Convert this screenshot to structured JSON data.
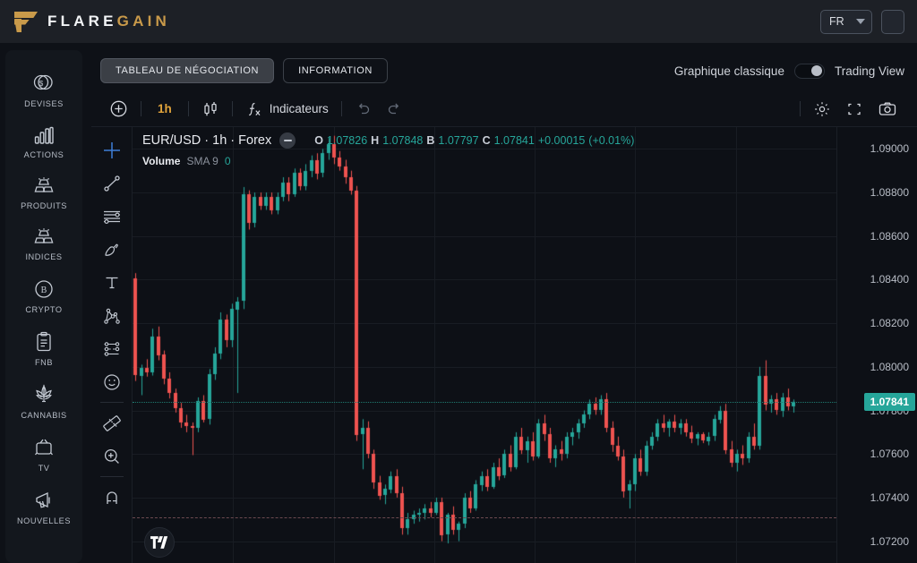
{
  "header": {
    "brand_white": "FLARE",
    "brand_gold": "GAIN",
    "language": "FR"
  },
  "sidebar": {
    "items": [
      {
        "label": "DEVISES",
        "icon": "coins-dollar-icon"
      },
      {
        "label": "ACTIONS",
        "icon": "bar-chart-icon"
      },
      {
        "label": "PRODUITS",
        "icon": "gold-bars-icon"
      },
      {
        "label": "INDICES",
        "icon": "gold-bars-icon"
      },
      {
        "label": "CRYPTO",
        "icon": "bitcoin-circle-icon"
      },
      {
        "label": "FNB",
        "icon": "clipboard-icon"
      },
      {
        "label": "CANNABIS",
        "icon": "cannabis-leaf-icon"
      },
      {
        "label": "TV",
        "icon": "television-icon"
      },
      {
        "label": "NOUVELLES",
        "icon": "megaphone-icon"
      }
    ]
  },
  "tabs": {
    "trading_board": "TABLEAU DE NÉGOCIATION",
    "information": "INFORMATION",
    "classic_chart_label": "Graphique classique",
    "trading_view_label": "Trading View",
    "toggle_state": "Trading View"
  },
  "chart_toolbar": {
    "add_label": "+",
    "interval": "1h",
    "chart_type_icon": "candlestick-icon",
    "indicators_label": "Indicateurs",
    "indicators_icon": "fx-icon",
    "undo_icon": "undo-icon",
    "redo_icon": "redo-icon",
    "settings_icon": "gear-icon",
    "fullscreen_icon": "fullscreen-icon",
    "snapshot_icon": "camera-icon"
  },
  "drawing_tools": [
    {
      "name": "crosshair-tool",
      "active": true
    },
    {
      "name": "trend-line-tool",
      "active": false
    },
    {
      "name": "horizontal-levels-tool",
      "active": false
    },
    {
      "name": "brush-tool",
      "active": false
    },
    {
      "name": "text-tool",
      "active": false
    },
    {
      "name": "pattern-tool",
      "active": false
    },
    {
      "name": "forecast-tool",
      "active": false
    },
    {
      "name": "emoji-tool",
      "active": false
    },
    {
      "name": "measure-tool",
      "active": false
    },
    {
      "name": "zoom-in-tool",
      "active": false
    },
    {
      "name": "magnet-tool",
      "active": false
    }
  ],
  "chart_data": {
    "type": "candlestick",
    "symbol": "EUR/USD",
    "interval": "1h",
    "exchange": "Forex",
    "title": "EUR/USD · 1h · Forex",
    "ohlc": {
      "o_label": "O",
      "o": "1.07826",
      "h_label": "H",
      "h": "1.07848",
      "b_label": "B",
      "b": "1.07797",
      "c_label": "C",
      "c": "1.07841",
      "change": "+0.00015",
      "change_pct": "(+0.01%)"
    },
    "volume_study": {
      "name": "Volume",
      "params": "SMA 9",
      "value": "0"
    },
    "current_price": "1.07841",
    "ylabel": "",
    "ylim": [
      1.071,
      1.091
    ],
    "yticks": [
      "1.09000",
      "1.08800",
      "1.08600",
      "1.08400",
      "1.08200",
      "1.08000",
      "1.07800",
      "1.07600",
      "1.07400",
      "1.07200"
    ],
    "ytick_values": [
      1.09,
      1.088,
      1.086,
      1.084,
      1.082,
      1.08,
      1.078,
      1.076,
      1.074,
      1.072
    ],
    "price_level_line": 1.07841,
    "low_level_line": 1.0731,
    "grid": true,
    "up_color": "#26a69a",
    "down_color": "#ef5350",
    "bars": [
      {
        "o": 1.08405,
        "h": 1.0843,
        "l": 1.07935,
        "c": 1.0796
      },
      {
        "o": 1.0796,
        "h": 1.0801,
        "l": 1.0787,
        "c": 1.07995
      },
      {
        "o": 1.07995,
        "h": 1.08035,
        "l": 1.07955,
        "c": 1.07975
      },
      {
        "o": 1.07975,
        "h": 1.08175,
        "l": 1.0796,
        "c": 1.0814
      },
      {
        "o": 1.0814,
        "h": 1.08185,
        "l": 1.0803,
        "c": 1.08055
      },
      {
        "o": 1.08055,
        "h": 1.08075,
        "l": 1.0792,
        "c": 1.07945
      },
      {
        "o": 1.07945,
        "h": 1.07975,
        "l": 1.07855,
        "c": 1.0788
      },
      {
        "o": 1.0788,
        "h": 1.079,
        "l": 1.0779,
        "c": 1.0781
      },
      {
        "o": 1.0781,
        "h": 1.07835,
        "l": 1.0772,
        "c": 1.07745
      },
      {
        "o": 1.07745,
        "h": 1.0778,
        "l": 1.077,
        "c": 1.0773
      },
      {
        "o": 1.0773,
        "h": 1.07745,
        "l": 1.07595,
        "c": 1.0772
      },
      {
        "o": 1.0772,
        "h": 1.0786,
        "l": 1.077,
        "c": 1.07845
      },
      {
        "o": 1.07845,
        "h": 1.0787,
        "l": 1.07745,
        "c": 1.0776
      },
      {
        "o": 1.0776,
        "h": 1.0799,
        "l": 1.07735,
        "c": 1.07965
      },
      {
        "o": 1.07965,
        "h": 1.0809,
        "l": 1.0794,
        "c": 1.0806
      },
      {
        "o": 1.0806,
        "h": 1.0825,
        "l": 1.08035,
        "c": 1.08215
      },
      {
        "o": 1.08215,
        "h": 1.0824,
        "l": 1.0809,
        "c": 1.0812
      },
      {
        "o": 1.0812,
        "h": 1.0829,
        "l": 1.0809,
        "c": 1.08265
      },
      {
        "o": 1.08265,
        "h": 1.0832,
        "l": 1.0788,
        "c": 1.083
      },
      {
        "o": 1.083,
        "h": 1.08825,
        "l": 1.08265,
        "c": 1.0879
      },
      {
        "o": 1.0879,
        "h": 1.0881,
        "l": 1.0863,
        "c": 1.0866
      },
      {
        "o": 1.0866,
        "h": 1.088,
        "l": 1.0864,
        "c": 1.0878
      },
      {
        "o": 1.0878,
        "h": 1.088,
        "l": 1.0872,
        "c": 1.0874
      },
      {
        "o": 1.0874,
        "h": 1.088,
        "l": 1.0872,
        "c": 1.0878
      },
      {
        "o": 1.0878,
        "h": 1.088,
        "l": 1.087,
        "c": 1.0872
      },
      {
        "o": 1.0872,
        "h": 1.088,
        "l": 1.087,
        "c": 1.0878
      },
      {
        "o": 1.0878,
        "h": 1.0887,
        "l": 1.0876,
        "c": 1.08845
      },
      {
        "o": 1.08845,
        "h": 1.0887,
        "l": 1.0876,
        "c": 1.0879
      },
      {
        "o": 1.0879,
        "h": 1.0891,
        "l": 1.0878,
        "c": 1.0889
      },
      {
        "o": 1.0889,
        "h": 1.0891,
        "l": 1.0881,
        "c": 1.0883
      },
      {
        "o": 1.0883,
        "h": 1.0893,
        "l": 1.0881,
        "c": 1.089
      },
      {
        "o": 1.089,
        "h": 1.0897,
        "l": 1.0887,
        "c": 1.0895
      },
      {
        "o": 1.0895,
        "h": 1.0898,
        "l": 1.0886,
        "c": 1.0889
      },
      {
        "o": 1.0889,
        "h": 1.09,
        "l": 1.0887,
        "c": 1.0898
      },
      {
        "o": 1.0898,
        "h": 1.0905,
        "l": 1.0895,
        "c": 1.0902
      },
      {
        "o": 1.0902,
        "h": 1.0906,
        "l": 1.0893,
        "c": 1.0896
      },
      {
        "o": 1.0896,
        "h": 1.0899,
        "l": 1.089,
        "c": 1.0892
      },
      {
        "o": 1.0892,
        "h": 1.0895,
        "l": 1.0884,
        "c": 1.0887
      },
      {
        "o": 1.0887,
        "h": 1.089,
        "l": 1.0879,
        "c": 1.0881
      },
      {
        "o": 1.0881,
        "h": 1.0883,
        "l": 1.0766,
        "c": 1.0769
      },
      {
        "o": 1.0769,
        "h": 1.0776,
        "l": 1.0753,
        "c": 1.0772
      },
      {
        "o": 1.0772,
        "h": 1.0775,
        "l": 1.0758,
        "c": 1.076
      },
      {
        "o": 1.076,
        "h": 1.0762,
        "l": 1.0744,
        "c": 1.0747
      },
      {
        "o": 1.0747,
        "h": 1.075,
        "l": 1.0739,
        "c": 1.0741
      },
      {
        "o": 1.0741,
        "h": 1.0746,
        "l": 1.0737,
        "c": 1.0744
      },
      {
        "o": 1.0744,
        "h": 1.0752,
        "l": 1.0742,
        "c": 1.075
      },
      {
        "o": 1.075,
        "h": 1.0753,
        "l": 1.074,
        "c": 1.0742
      },
      {
        "o": 1.0742,
        "h": 1.0745,
        "l": 1.0723,
        "c": 1.0726
      },
      {
        "o": 1.0726,
        "h": 1.0733,
        "l": 1.0723,
        "c": 1.073
      },
      {
        "o": 1.073,
        "h": 1.0734,
        "l": 1.0728,
        "c": 1.0732
      },
      {
        "o": 1.0732,
        "h": 1.0735,
        "l": 1.0729,
        "c": 1.0733
      },
      {
        "o": 1.0733,
        "h": 1.0737,
        "l": 1.073,
        "c": 1.0735
      },
      {
        "o": 1.0735,
        "h": 1.0738,
        "l": 1.0731,
        "c": 1.0733
      },
      {
        "o": 1.0733,
        "h": 1.074,
        "l": 1.0732,
        "c": 1.0738
      },
      {
        "o": 1.0738,
        "h": 1.074,
        "l": 1.072,
        "c": 1.0723
      },
      {
        "o": 1.0723,
        "h": 1.0733,
        "l": 1.0719,
        "c": 1.0732
      },
      {
        "o": 1.0732,
        "h": 1.0736,
        "l": 1.0723,
        "c": 1.0725
      },
      {
        "o": 1.0725,
        "h": 1.0729,
        "l": 1.072,
        "c": 1.0728
      },
      {
        "o": 1.0728,
        "h": 1.0742,
        "l": 1.0726,
        "c": 1.074
      },
      {
        "o": 1.074,
        "h": 1.0743,
        "l": 1.0733,
        "c": 1.0735
      },
      {
        "o": 1.0735,
        "h": 1.0748,
        "l": 1.0734,
        "c": 1.0746
      },
      {
        "o": 1.0746,
        "h": 1.0752,
        "l": 1.0743,
        "c": 1.075
      },
      {
        "o": 1.075,
        "h": 1.0753,
        "l": 1.0743,
        "c": 1.0745
      },
      {
        "o": 1.0745,
        "h": 1.0756,
        "l": 1.0744,
        "c": 1.0754
      },
      {
        "o": 1.0754,
        "h": 1.0758,
        "l": 1.0748,
        "c": 1.075
      },
      {
        "o": 1.075,
        "h": 1.0762,
        "l": 1.0749,
        "c": 1.076
      },
      {
        "o": 1.076,
        "h": 1.0764,
        "l": 1.0752,
        "c": 1.0754
      },
      {
        "o": 1.0754,
        "h": 1.077,
        "l": 1.0753,
        "c": 1.0768
      },
      {
        "o": 1.0768,
        "h": 1.0772,
        "l": 1.076,
        "c": 1.0762
      },
      {
        "o": 1.0762,
        "h": 1.0768,
        "l": 1.0756,
        "c": 1.0766
      },
      {
        "o": 1.0766,
        "h": 1.077,
        "l": 1.0757,
        "c": 1.0759
      },
      {
        "o": 1.0759,
        "h": 1.0776,
        "l": 1.0758,
        "c": 1.0774
      },
      {
        "o": 1.0774,
        "h": 1.0778,
        "l": 1.0766,
        "c": 1.0769
      },
      {
        "o": 1.0769,
        "h": 1.0772,
        "l": 1.0756,
        "c": 1.0758
      },
      {
        "o": 1.0758,
        "h": 1.0764,
        "l": 1.0754,
        "c": 1.0762
      },
      {
        "o": 1.0762,
        "h": 1.0766,
        "l": 1.0757,
        "c": 1.076
      },
      {
        "o": 1.076,
        "h": 1.077,
        "l": 1.0758,
        "c": 1.0768
      },
      {
        "o": 1.0768,
        "h": 1.0772,
        "l": 1.0764,
        "c": 1.077
      },
      {
        "o": 1.077,
        "h": 1.0776,
        "l": 1.0767,
        "c": 1.0774
      },
      {
        "o": 1.0774,
        "h": 1.078,
        "l": 1.0772,
        "c": 1.0778
      },
      {
        "o": 1.0778,
        "h": 1.0785,
        "l": 1.0776,
        "c": 1.0783
      },
      {
        "o": 1.0783,
        "h": 1.0786,
        "l": 1.0778,
        "c": 1.078
      },
      {
        "o": 1.078,
        "h": 1.0787,
        "l": 1.0778,
        "c": 1.0785
      },
      {
        "o": 1.0785,
        "h": 1.0788,
        "l": 1.077,
        "c": 1.0772
      },
      {
        "o": 1.0772,
        "h": 1.0775,
        "l": 1.0761,
        "c": 1.0764
      },
      {
        "o": 1.0764,
        "h": 1.0768,
        "l": 1.0757,
        "c": 1.0759
      },
      {
        "o": 1.0759,
        "h": 1.0762,
        "l": 1.074,
        "c": 1.0743
      },
      {
        "o": 1.0743,
        "h": 1.0748,
        "l": 1.0735,
        "c": 1.0746
      },
      {
        "o": 1.0746,
        "h": 1.076,
        "l": 1.0743,
        "c": 1.0758
      },
      {
        "o": 1.0758,
        "h": 1.0762,
        "l": 1.075,
        "c": 1.0752
      },
      {
        "o": 1.0752,
        "h": 1.0766,
        "l": 1.075,
        "c": 1.0764
      },
      {
        "o": 1.0764,
        "h": 1.077,
        "l": 1.0762,
        "c": 1.0768
      },
      {
        "o": 1.0768,
        "h": 1.0776,
        "l": 1.0766,
        "c": 1.0774
      },
      {
        "o": 1.0774,
        "h": 1.0778,
        "l": 1.077,
        "c": 1.0772
      },
      {
        "o": 1.0772,
        "h": 1.0776,
        "l": 1.0768,
        "c": 1.0775
      },
      {
        "o": 1.0775,
        "h": 1.0778,
        "l": 1.077,
        "c": 1.0772
      },
      {
        "o": 1.0772,
        "h": 1.0776,
        "l": 1.0769,
        "c": 1.0774
      },
      {
        "o": 1.0774,
        "h": 1.0776,
        "l": 1.0768,
        "c": 1.077
      },
      {
        "o": 1.077,
        "h": 1.0773,
        "l": 1.0765,
        "c": 1.0767
      },
      {
        "o": 1.0767,
        "h": 1.077,
        "l": 1.0764,
        "c": 1.0769
      },
      {
        "o": 1.0769,
        "h": 1.077,
        "l": 1.0765,
        "c": 1.0766
      },
      {
        "o": 1.0766,
        "h": 1.077,
        "l": 1.0764,
        "c": 1.0768
      },
      {
        "o": 1.0768,
        "h": 1.0778,
        "l": 1.0766,
        "c": 1.0776
      },
      {
        "o": 1.0776,
        "h": 1.0782,
        "l": 1.0774,
        "c": 1.078
      },
      {
        "o": 1.078,
        "h": 1.0783,
        "l": 1.076,
        "c": 1.0762
      },
      {
        "o": 1.0762,
        "h": 1.0766,
        "l": 1.0754,
        "c": 1.0756
      },
      {
        "o": 1.0756,
        "h": 1.0762,
        "l": 1.0752,
        "c": 1.076
      },
      {
        "o": 1.076,
        "h": 1.0764,
        "l": 1.0755,
        "c": 1.0758
      },
      {
        "o": 1.0758,
        "h": 1.077,
        "l": 1.0756,
        "c": 1.0768
      },
      {
        "o": 1.0768,
        "h": 1.0774,
        "l": 1.0762,
        "c": 1.0764
      },
      {
        "o": 1.0764,
        "h": 1.08,
        "l": 1.0762,
        "c": 1.0796
      },
      {
        "o": 1.0796,
        "h": 1.0803,
        "l": 1.078,
        "c": 1.0783
      },
      {
        "o": 1.0783,
        "h": 1.0787,
        "l": 1.0779,
        "c": 1.0785
      },
      {
        "o": 1.0785,
        "h": 1.0788,
        "l": 1.0778,
        "c": 1.078
      },
      {
        "o": 1.078,
        "h": 1.0788,
        "l": 1.0777,
        "c": 1.0786
      },
      {
        "o": 1.0786,
        "h": 1.079,
        "l": 1.078,
        "c": 1.0782
      },
      {
        "o": 1.0782,
        "h": 1.0785,
        "l": 1.0779,
        "c": 1.07841
      }
    ]
  }
}
